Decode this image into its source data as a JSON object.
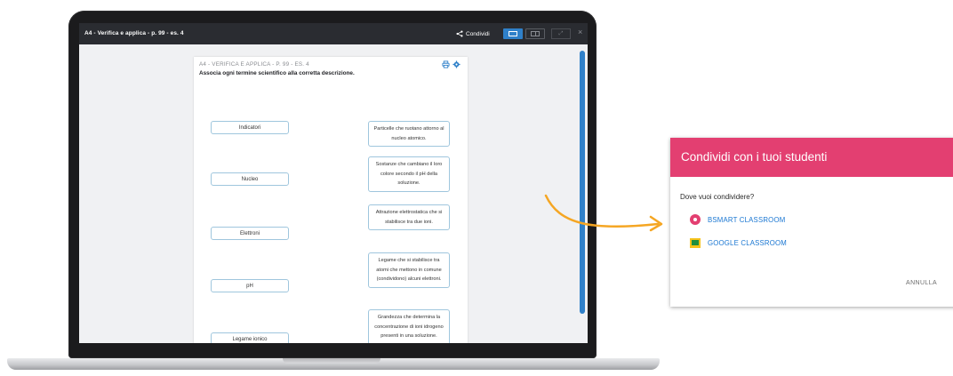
{
  "app": {
    "title": "A4 - Verifica e applica - p. 99 - es. 4",
    "share_label": "Condividi",
    "expand_glyph": "⤢",
    "close_glyph": "×"
  },
  "document": {
    "heading": "A4 - VERIFICA E APPLICA - P. 99 - ES. 4",
    "instruction": "Associa ogni termine scientifico alla corretta descrizione.",
    "terms": [
      "Indicatori",
      "Nucleo",
      "Elettroni",
      "pH",
      "Legame ionico"
    ],
    "descriptions": [
      "Particelle che ruotano attorno al nucleo atomico.",
      "Sostanze che cambiano il loro colore secondo il pH della soluzione.",
      "Attrazione elettrostatica che si stabilisce tra due ioni.",
      "Legame che si stabilisce tra atomi che mettono in comune (condividono) alcuni elettroni.",
      "Grandezza che determina la concentrazione di ioni idrogeno presenti in una soluzione."
    ]
  },
  "dialog": {
    "title": "Condividi con i tuoi studenti",
    "question": "Dove vuoi condividere?",
    "options": [
      "BSMART CLASSROOM",
      "GOOGLE CLASSROOM"
    ],
    "cancel_label": "ANNULLA"
  },
  "colors": {
    "accent_blue": "#2f80c9",
    "dialog_header": "#e33f71",
    "arrow": "#f5a623",
    "link_blue": "#1976d2"
  }
}
